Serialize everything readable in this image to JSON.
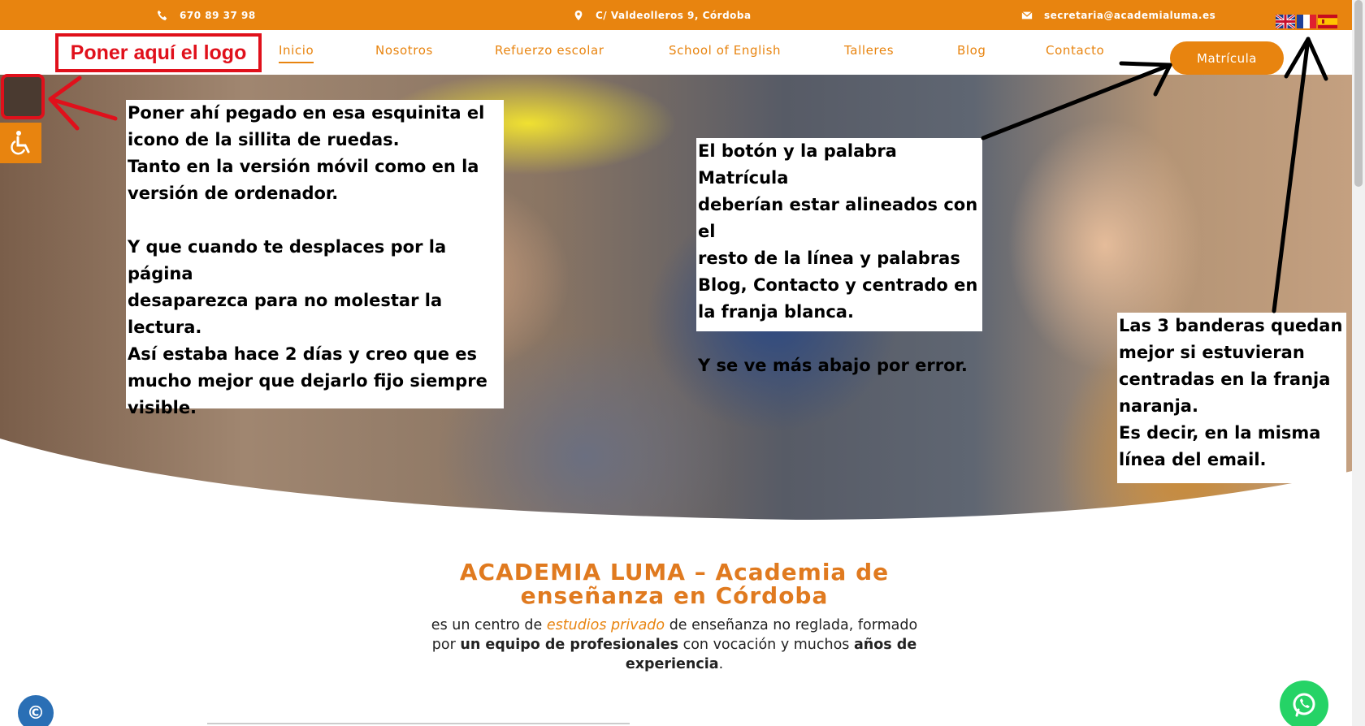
{
  "topbar": {
    "phone": "670 89 37 98",
    "address": "C/ Valdeolleros 9, Córdoba",
    "email": "secretaria@academialuma.es",
    "flags": [
      "flag-uk-icon",
      "flag-fr-icon",
      "flag-es-icon"
    ]
  },
  "nav": {
    "logo_placeholder": "Poner aquí el logo",
    "links": [
      "Inicio",
      "Nosotros",
      "Refuerzo escolar",
      "School of English",
      "Talleres",
      "Blog",
      "Contacto"
    ],
    "cta": "Matrícula"
  },
  "notes": {
    "wheelchair": "Poner ahí pegado en esa esquinita el\nicono de la sillita de ruedas.\nTanto en la versión móvil como en la\nversión de ordenador.\n\nY que cuando te desplaces por la página\ndesaparezca para no molestar la lectura.\nAsí estaba hace 2 días y creo que es\nmucho mejor que dejarlo fijo siempre\nvisible.",
    "button": "El botón y la palabra Matrícula\ndeberían estar alineados con el\nresto de la línea y palabras\nBlog, Contacto  y centrado en\n la franja blanca.\n\nY se ve más abajo por error.",
    "flags": "Las 3 banderas quedan\nmejor si estuvieran\ncentradas en la franja\nnaranja.\nEs decir, en la misma\nlínea del email."
  },
  "intro": {
    "title": "ACADEMIA LUMA – Academia de enseñanza en Córdoba",
    "text_1": "es un centro de ",
    "text_em": "estudios privado",
    "text_2": " de enseñanza no reglada, formado por ",
    "text_b1": "un equipo de profesionales",
    "text_3": " con vocación y muchos ",
    "text_b2": "años de experiencia",
    "text_4": "."
  },
  "colors": {
    "brand_orange": "#e8840f",
    "annotation_red": "#e0101b",
    "whatsapp_green": "#25d366"
  }
}
